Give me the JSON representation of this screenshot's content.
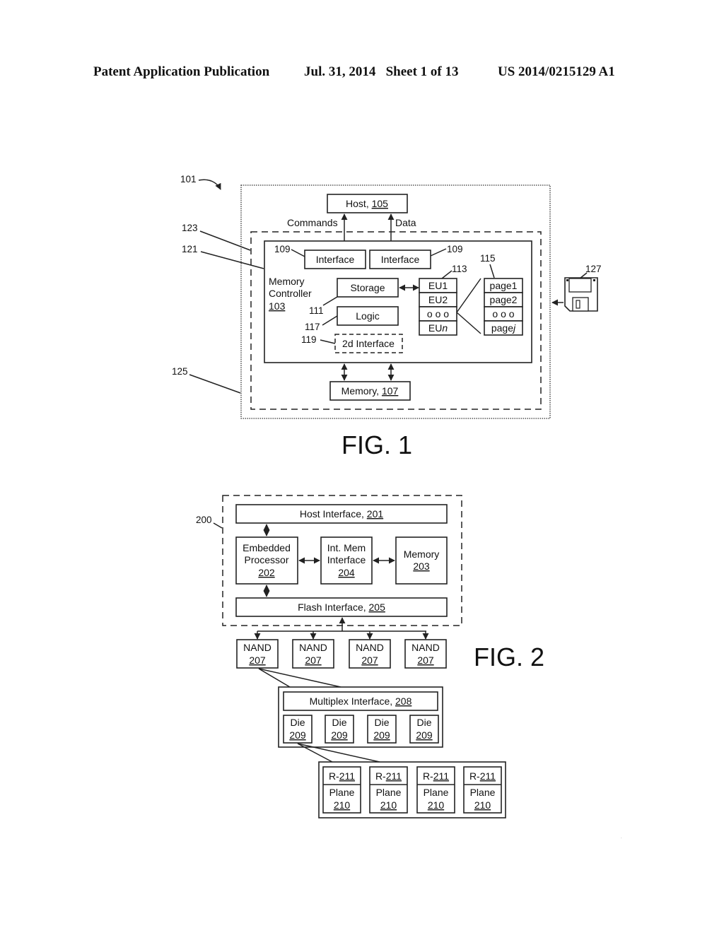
{
  "header": {
    "publication_type": "Patent Application Publication",
    "date_sheet": "Jul. 31, 2014   Sheet 1 of 13",
    "patent_number": "US 2014/0215129 A1"
  },
  "fig1": {
    "caption": "FIG. 1",
    "refs": {
      "system": "101",
      "r123": "123",
      "r121": "121",
      "r125": "125",
      "r109a": "109",
      "r109b": "109",
      "r113": "113",
      "r115": "115",
      "r111": "111",
      "r117": "117",
      "r119": "119",
      "r127": "127"
    },
    "host": {
      "label": "Host, ",
      "ref": "105"
    },
    "commands_label": "Commands",
    "data_label": "Data",
    "interface_left": "Interface",
    "interface_right": "Interface",
    "controller": {
      "line1": "Memory",
      "line2": "Controller",
      "ref": "103"
    },
    "storage": "Storage",
    "logic": "Logic",
    "second_interface": "2d Interface",
    "eu_blocks": [
      "EU1",
      "EU2",
      "o o o",
      "EUn"
    ],
    "pages": [
      "page1",
      "page2",
      "o o o",
      "pagej"
    ],
    "memory": {
      "label": "Memory, ",
      "ref": "107"
    },
    "media_icon": "floppy-disk-icon"
  },
  "fig2": {
    "caption": "FIG. 2",
    "ref_system": "200",
    "host_interface": {
      "label": "Host Interface, ",
      "ref": "201"
    },
    "embedded_processor": {
      "line1": "Embedded",
      "line2": "Processor",
      "ref": "202"
    },
    "int_mem_interface": {
      "line1": "Int. Mem",
      "line2": "Interface",
      "ref": "204"
    },
    "memory": {
      "line1": "Memory",
      "ref": "203"
    },
    "flash_interface": {
      "label": "Flash Interface, ",
      "ref": "205"
    },
    "nand": [
      {
        "label": "NAND",
        "ref": "207"
      },
      {
        "label": "NAND",
        "ref": "207"
      },
      {
        "label": "NAND",
        "ref": "207"
      },
      {
        "label": "NAND",
        "ref": "207"
      }
    ],
    "multiplex_interface": {
      "label": "Multiplex Interface, ",
      "ref": "208"
    },
    "dies": [
      {
        "label": "Die",
        "ref": "209"
      },
      {
        "label": "Die",
        "ref": "209"
      },
      {
        "label": "Die",
        "ref": "209"
      },
      {
        "label": "Die",
        "ref": "209"
      }
    ],
    "planes": [
      {
        "reg_prefix": "R-",
        "reg_ref": "211",
        "label": "Plane",
        "ref": "210"
      },
      {
        "reg_prefix": "R-",
        "reg_ref": "211",
        "label": "Plane",
        "ref": "210"
      },
      {
        "reg_prefix": "R-",
        "reg_ref": "211",
        "label": "Plane",
        "ref": "210"
      },
      {
        "reg_prefix": "R-",
        "reg_ref": "211",
        "label": "Plane",
        "ref": "210"
      }
    ]
  }
}
